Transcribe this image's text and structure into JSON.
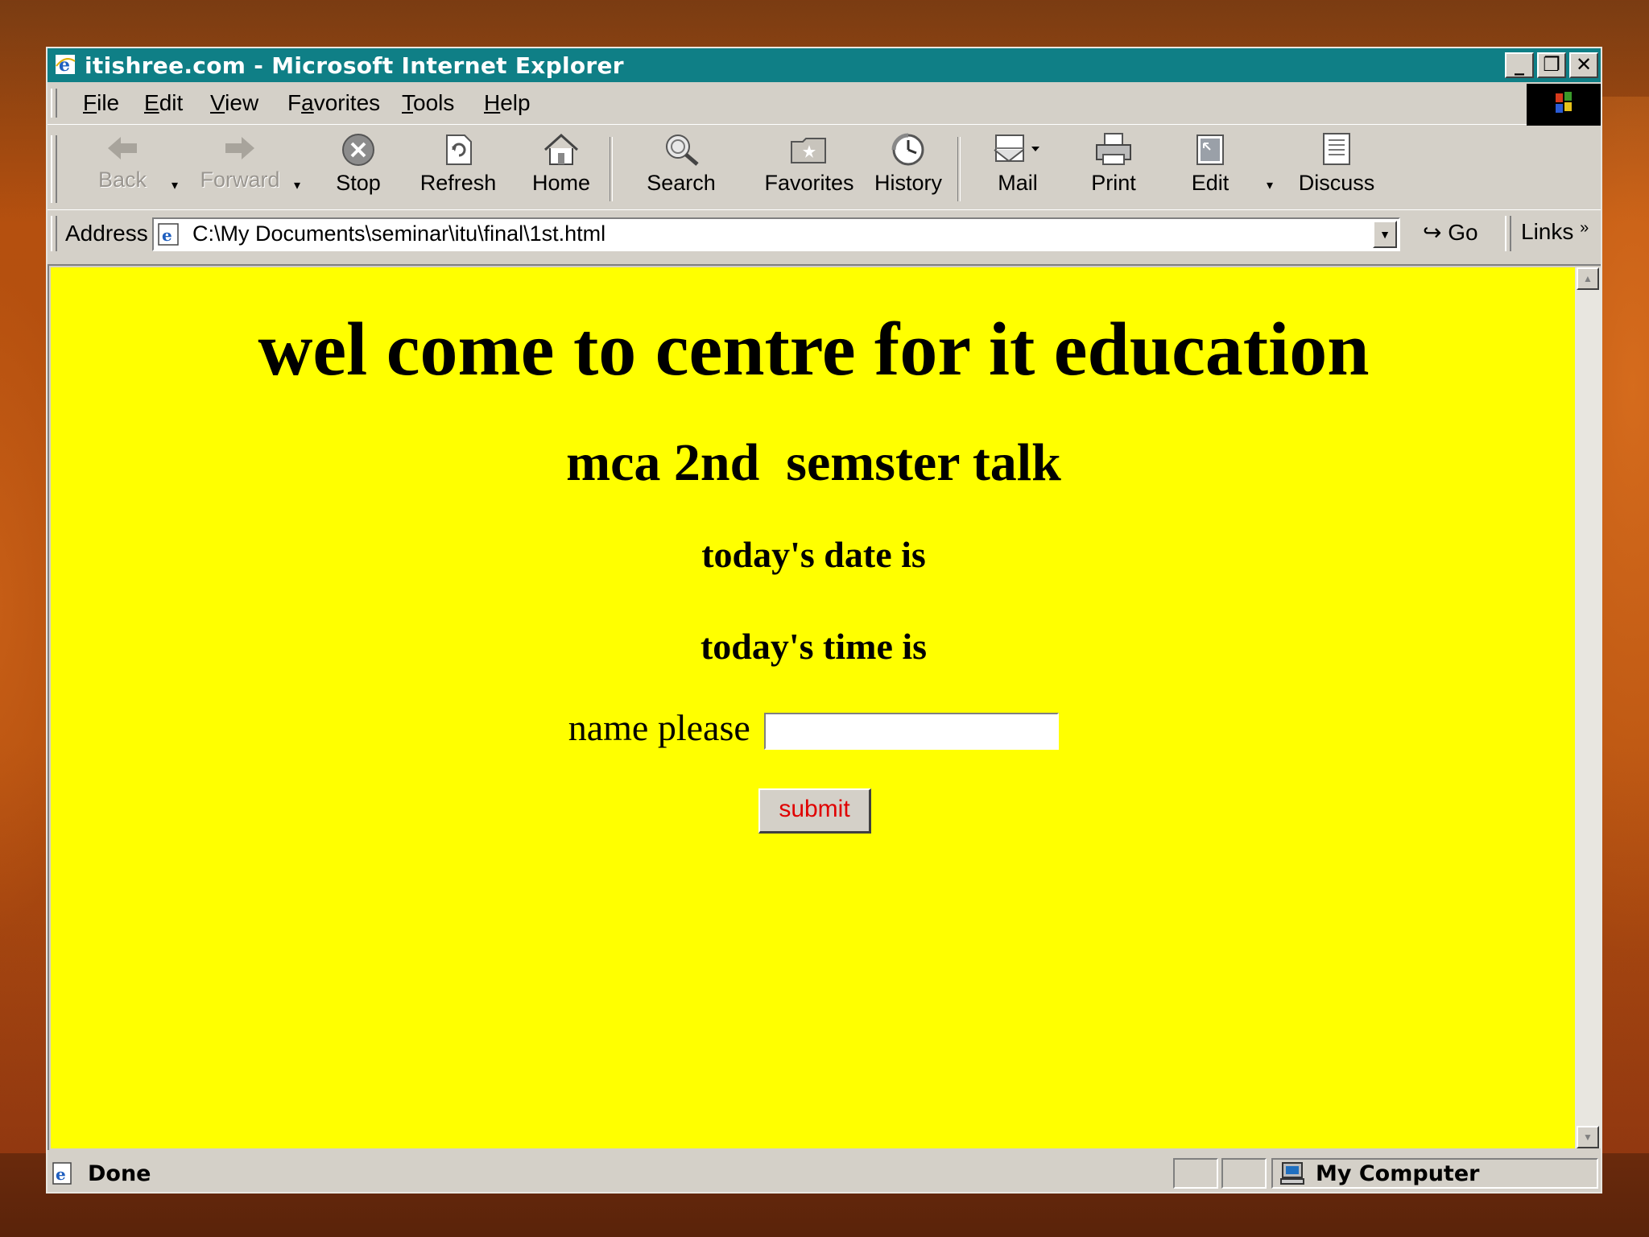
{
  "window": {
    "title": "itishree.com - Microsoft Internet Explorer",
    "controls": {
      "minimize": "_",
      "restore": "❐",
      "close": "✕"
    }
  },
  "menu": [
    {
      "pre": "",
      "u": "F",
      "post": "ile"
    },
    {
      "pre": "",
      "u": "E",
      "post": "dit"
    },
    {
      "pre": "",
      "u": "V",
      "post": "iew"
    },
    {
      "pre": "F",
      "u": "a",
      "post": "vorites"
    },
    {
      "pre": "",
      "u": "T",
      "post": "ools"
    },
    {
      "pre": "",
      "u": "H",
      "post": "elp"
    }
  ],
  "toolbar": {
    "back": "Back",
    "forward": "Forward",
    "stop": "Stop",
    "refresh": "Refresh",
    "home": "Home",
    "search": "Search",
    "favorites": "Favorites",
    "history": "History",
    "mail": "Mail",
    "print": "Print",
    "edit": "Edit",
    "discuss": "Discuss"
  },
  "address": {
    "label": "Address",
    "url": "C:\\My Documents\\seminar\\itu\\final\\1st.html",
    "go": "Go",
    "links": "Links"
  },
  "page": {
    "heading": "wel come to centre for it education",
    "subheading": "mca 2nd  semster talk",
    "date_line": "today's date is",
    "time_line": "today's time is",
    "name_label": "name please",
    "name_value": "",
    "submit": "submit",
    "background": "#ffff00",
    "submit_text_color": "#e00000"
  },
  "status": {
    "text": "Done",
    "zone": "My Computer"
  },
  "colors": {
    "titlebar": "#0f7f86",
    "chrome": "#d4d0c8"
  }
}
